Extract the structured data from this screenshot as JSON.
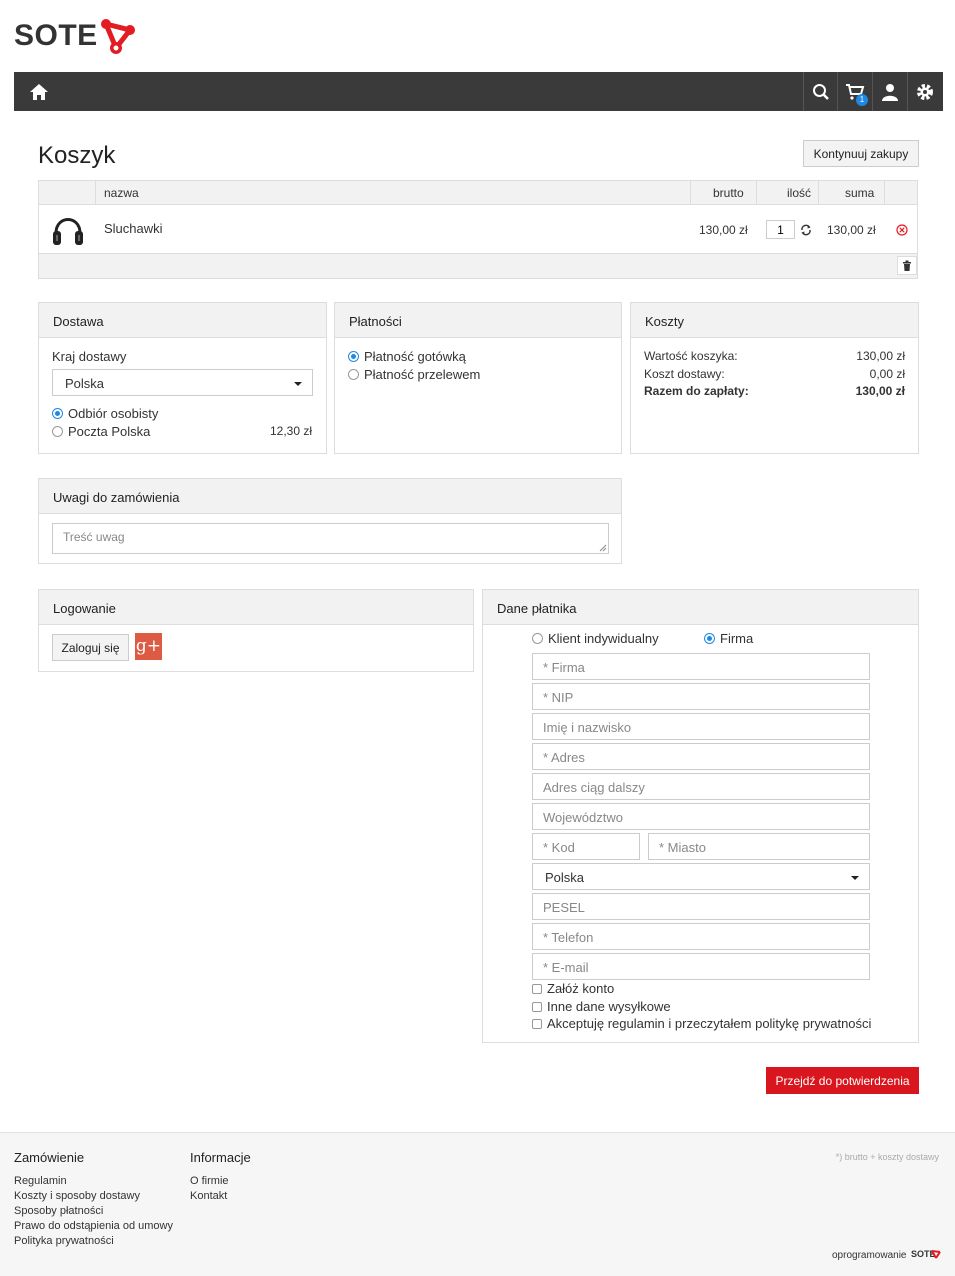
{
  "brand": {
    "name": "SOTE",
    "accent": "#e31b23"
  },
  "nav": {
    "cart_count": "1",
    "icons": [
      "home-icon",
      "search-icon",
      "cart-icon",
      "user-icon",
      "gear-icon"
    ]
  },
  "page": {
    "title": "Koszyk",
    "continue_label": "Kontynuuj zakupy"
  },
  "cart": {
    "headers": {
      "name": "nazwa",
      "gross": "brutto",
      "qty": "ilość",
      "sum": "suma"
    },
    "items": [
      {
        "name": "Sluchawki",
        "price": "130,00 zł",
        "qty": "1",
        "sum": "130,00 zł"
      }
    ]
  },
  "delivery": {
    "title": "Dostawa",
    "country_label": "Kraj dostawy",
    "country_value": "Polska",
    "options": [
      {
        "label": "Odbiór osobisty",
        "price": "",
        "selected": true
      },
      {
        "label": "Poczta Polska",
        "price": "12,30 zł",
        "selected": false
      }
    ]
  },
  "payments": {
    "title": "Płatności",
    "options": [
      {
        "label": "Płatność gotówką",
        "selected": true
      },
      {
        "label": "Płatność przelewem",
        "selected": false
      }
    ]
  },
  "costs": {
    "title": "Koszty",
    "cart_value_label": "Wartość koszyka:",
    "cart_value": "130,00 zł",
    "shipping_label": "Koszt dostawy:",
    "shipping": "0,00 zł",
    "total_label": "Razem do zapłaty:",
    "total": "130,00 zł"
  },
  "notes": {
    "title": "Uwagi do zamówienia",
    "placeholder": "Treść uwag"
  },
  "login": {
    "title": "Logowanie",
    "button": "Zaloguj się",
    "gplus": "g+"
  },
  "payer": {
    "title": "Dane płatnika",
    "type_individual": "Klient indywidualny",
    "type_company": "Firma",
    "fields": {
      "company": "* Firma",
      "nip": "* NIP",
      "name": "Imię i nazwisko",
      "address": "* Adres",
      "address2": "Adres ciąg dalszy",
      "region": "Województwo",
      "zip": "* Kod",
      "city": "* Miasto",
      "country": "Polska",
      "pesel": "PESEL",
      "phone": "* Telefon",
      "email": "* E-mail"
    },
    "checks": {
      "create_account": "Załóż konto",
      "other_shipping": "Inne dane wysyłkowe",
      "accept_terms": "Akceptuję regulamin i przeczytałem politykę prywatności"
    }
  },
  "submit_label": "Przejdź do potwierdzenia",
  "footer": {
    "order_title": "Zamówienie",
    "order_links": [
      "Regulamin",
      "Koszty i sposoby dostawy",
      "Sposoby płatności",
      "Prawo do odstąpienia od umowy",
      "Polityka prywatności"
    ],
    "info_title": "Informacje",
    "info_links": [
      "O firmie",
      "Kontakt"
    ],
    "note": "*) brutto + koszty dostawy",
    "software_label": "oprogramowanie",
    "software_brand": "SOTE"
  }
}
